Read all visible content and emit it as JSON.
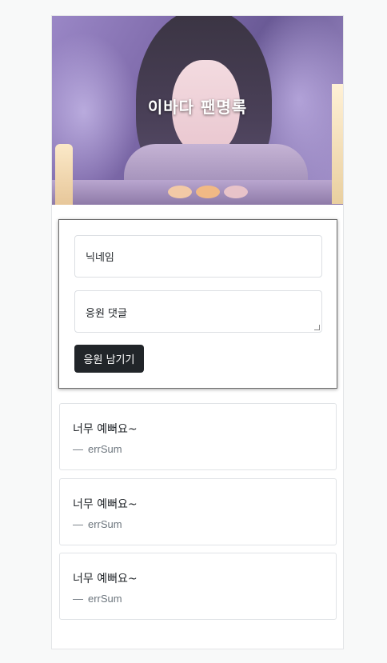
{
  "banner": {
    "title": "이바다 팬명록"
  },
  "form": {
    "nickname_placeholder": "닉네임",
    "comment_placeholder": "응원 댓글",
    "submit_label": "응원 남기기"
  },
  "comments": [
    {
      "text": "너무 예뻐요~",
      "dash": "—",
      "author": "errSum"
    },
    {
      "text": "너무 예뻐요~",
      "dash": "—",
      "author": "errSum"
    },
    {
      "text": "너무 예뻐요~",
      "dash": "—",
      "author": "errSum"
    }
  ]
}
